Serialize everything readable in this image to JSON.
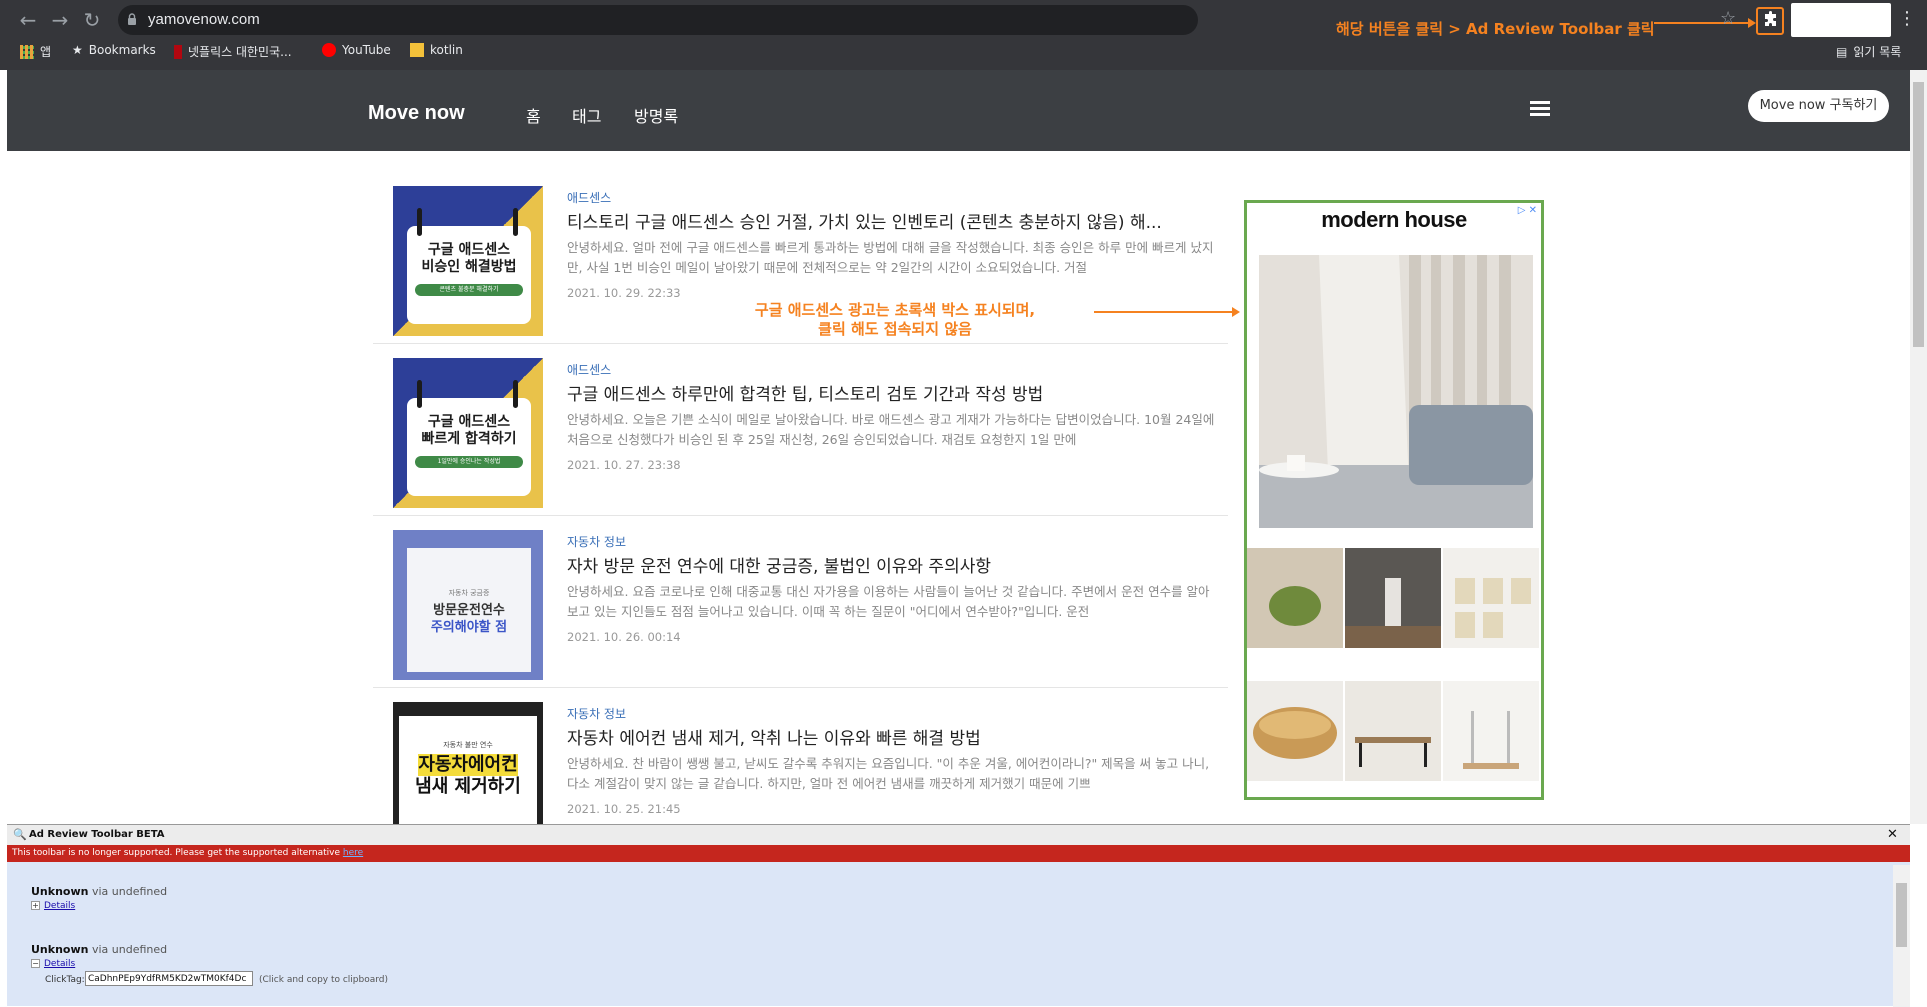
{
  "browser": {
    "url": "yamovenow.com",
    "bookmarks": [
      {
        "label": "앱",
        "icon": "apps-grid-icon"
      },
      {
        "label": "Bookmarks",
        "icon": "star-icon"
      },
      {
        "label": "넷플릭스 대한민국...",
        "icon": "netflix-icon"
      },
      {
        "label": "YouTube",
        "icon": "youtube-icon"
      },
      {
        "label": "kotlin",
        "icon": "folder-icon"
      }
    ],
    "reading_list": "읽기 목록",
    "annotation_top": "해당 버튼을 클릭 > Ad Review Toolbar 클릭",
    "accent_color": "#f58220"
  },
  "site": {
    "title": "Move now",
    "nav": [
      "홈",
      "태그",
      "방명록"
    ],
    "subscribe": "Move now 구독하기"
  },
  "posts": [
    {
      "category": "애드센스",
      "title": "티스토리 구글 애드센스 승인 거절, 가치 있는 인벤토리 (콘텐츠 충분하지 않음) 해...",
      "excerpt": "안녕하세요. 얼마 전에 구글 애드센스를 빠르게 통과하는 방법에 대해 글을 작성했습니다. 최종 승인은 하루 만에 빠르게 났지만, 사실 1번 비승인 메일이 날아왔기 때문에 전체적으로는 약 2일간의 시간이 소요되었습니다. 거절",
      "date": "2021. 10. 29. 22:33",
      "thumb_text": [
        "구글 애드센스",
        "비승인 해결방법",
        "콘텐츠 불충분 해결하기"
      ]
    },
    {
      "category": "애드센스",
      "title": "구글 애드센스 하루만에 합격한 팁, 티스토리 검토 기간과 작성 방법",
      "excerpt": "안녕하세요. 오늘은 기쁜 소식이 메일로 날아왔습니다. 바로 애드센스 광고 게재가 가능하다는 답변이었습니다. 10월 24일에 처음으로 신청했다가 비승인 된 후 25일 재신청, 26일 승인되었습니다. 재검토 요청한지 1일 만에",
      "date": "2021. 10. 27. 23:38",
      "thumb_text": [
        "구글 애드센스",
        "빠르게 합격하기",
        "1일만에 승인나는 작성법"
      ]
    },
    {
      "category": "자동차 정보",
      "title": "자차 방문 운전 연수에 대한 궁금증, 불법인 이유와 주의사항",
      "excerpt": "안녕하세요. 요즘 코로나로 인해 대중교통 대신 자가용을 이용하는 사람들이 늘어난 것 같습니다. 주변에서 운전 연수를 알아보고 있는 지인들도 점점 늘어나고 있습니다. 이때 꼭 하는 질문이 \"어디에서 연수받아?\"입니다. 운전",
      "date": "2021. 10. 26. 00:14",
      "thumb_text": [
        "자동차 궁금증",
        "방문운전연수",
        "주의해야할 점"
      ]
    },
    {
      "category": "자동차 정보",
      "title": "자동차 에어컨 냄새 제거, 악취 나는 이유와 빠른 해결 방법",
      "excerpt": "안녕하세요. 찬 바람이 쌩쌩 불고, 낟씨도 갈수록 추워지는 요즘입니다. \"이 추운 겨울, 에어컨이라니?\" 제목을 써 놓고 나니, 다소 계절감이 맞지 않는 글 같습니다. 하지만, 얼마 전 에어컨 냄새를 깨끗하게 제거했기 때문에 기쁘",
      "date": "2021. 10. 25. 21:45",
      "thumb_text": [
        "자동차 불만 연수",
        "자동차에어컨",
        "냄새 제거하기"
      ]
    }
  ],
  "ad": {
    "brand": "modern house",
    "annotation": "구글 애드센스 광고는 초록색 박스 표시되며,\n클릭 해도 접속되지 않음",
    "border_color": "#6aa84f"
  },
  "toolbar": {
    "title": "Ad Review Toolbar BETA",
    "warning": "This toolbar is no longer supported. Please get the supported alternative",
    "warning_link": "here",
    "entries": [
      {
        "name": "Unknown",
        "via": "via undefined",
        "details": "Details",
        "expanded": false
      },
      {
        "name": "Unknown",
        "via": "via undefined",
        "details": "Details",
        "expanded": true
      }
    ],
    "clicktag_label": "ClickTag:",
    "clicktag_value": "CaDhnPEp9YdfRM5KD2wTM0Kf4Dc",
    "clicktag_hint": "(Click and copy to clipboard)"
  }
}
